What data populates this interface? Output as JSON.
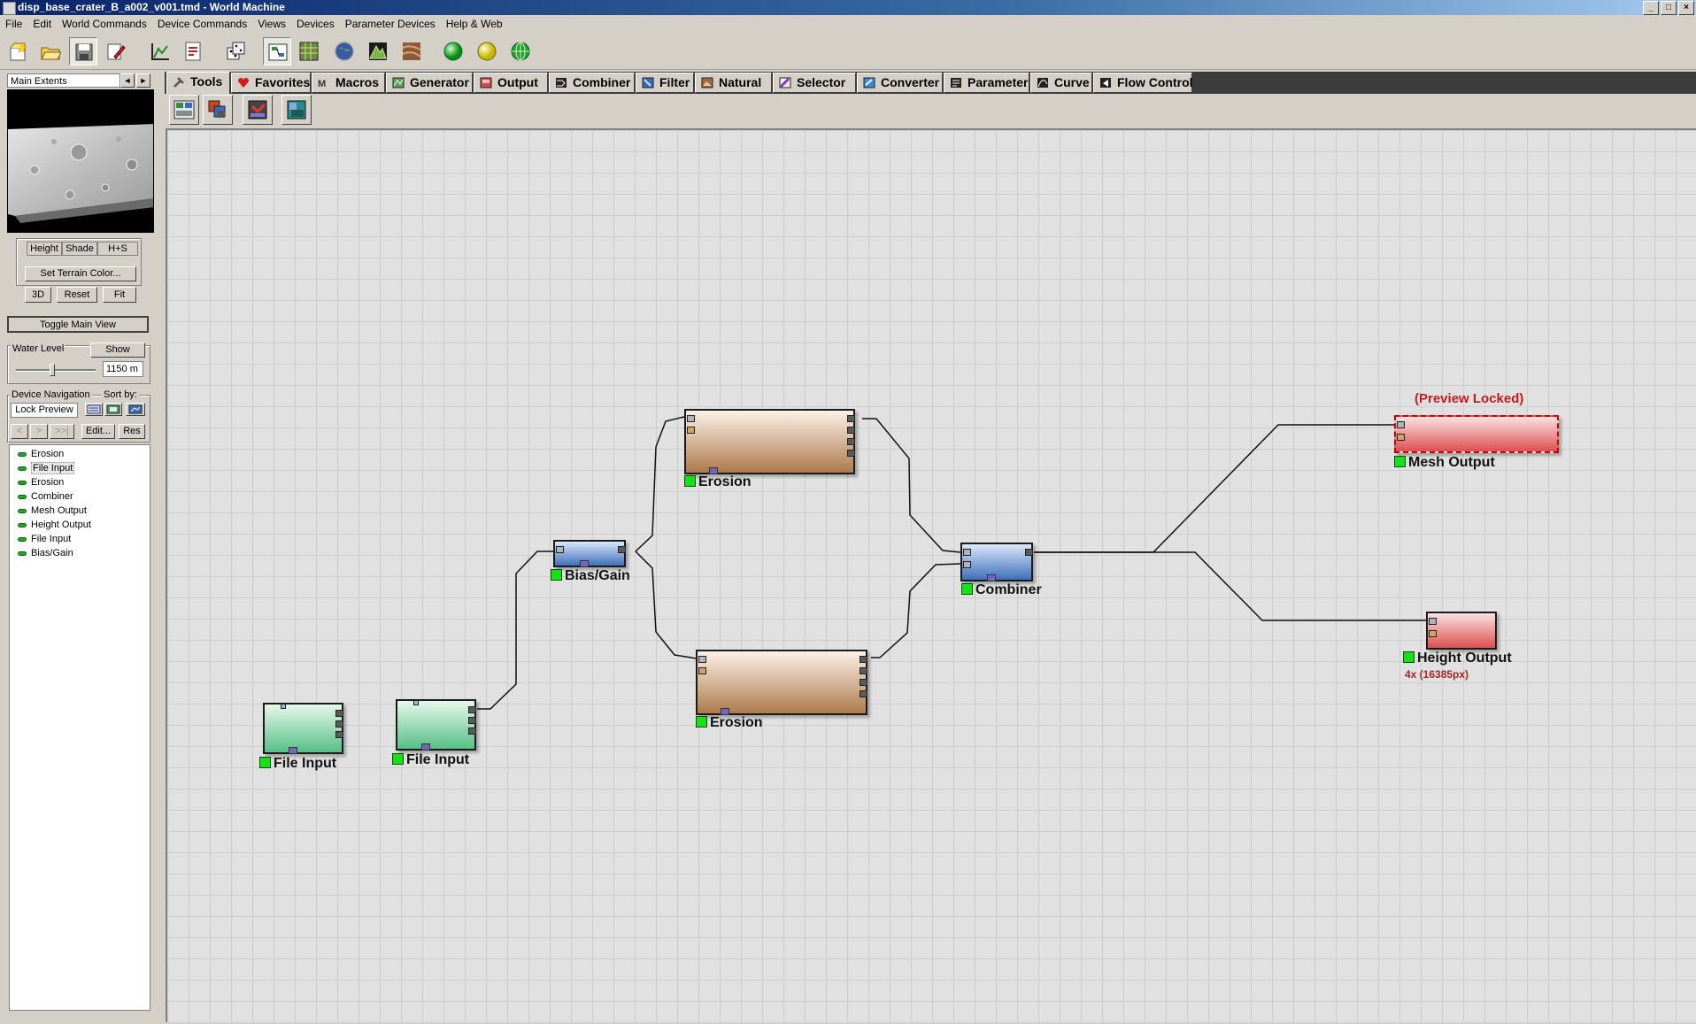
{
  "window": {
    "title": "disp_base_crater_B_a002_v001.tmd - World Machine"
  },
  "menu": [
    "File",
    "Edit",
    "World Commands",
    "Device Commands",
    "Views",
    "Devices",
    "Parameter Devices",
    "Help & Web"
  ],
  "toolbar_icons": [
    "new-file-icon",
    "open-folder-icon",
    "save-icon",
    "edit-script-icon",
    "chart-icon",
    "report-icon",
    "dice-icon",
    "layout-view-icon",
    "grid-view-icon",
    "globe-icon",
    "terrain-icon",
    "texture-icon",
    "build-green-icon",
    "build-yellow-icon",
    "world-build-icon"
  ],
  "left_panel": {
    "extents_label": "Main Extents",
    "view_buttons": [
      "Height",
      "Shade",
      "H+S"
    ],
    "set_terrain_color": "Set Terrain Color...",
    "cam_buttons": [
      "3D",
      "Reset",
      "Fit"
    ],
    "toggle_main_view": "Toggle Main View",
    "water_level_label": "Water Level",
    "water_show": "Show",
    "water_value": "1150 m",
    "device_nav_label": "Device Navigation",
    "sort_by_label": "Sort by:",
    "lock_preview": "Lock Preview",
    "nav_buttons": [
      "<",
      ">",
      ">>|"
    ],
    "edit_button": "Edit...",
    "res_button": "Res",
    "device_list": [
      "Erosion",
      "File Input",
      "Erosion",
      "Combiner",
      "Mesh Output",
      "Height Output",
      "File Input",
      "Bias/Gain"
    ],
    "selected_index": 1
  },
  "tabs": [
    {
      "label": "Tools",
      "icon": "tools-icon",
      "active": true
    },
    {
      "label": "Favorites",
      "icon": "heart-icon"
    },
    {
      "label": "Macros",
      "icon": "macro-icon"
    },
    {
      "label": "Generator",
      "icon": "generator-icon"
    },
    {
      "label": "Output",
      "icon": "output-icon"
    },
    {
      "label": "Combiner",
      "icon": "combiner-icon"
    },
    {
      "label": "Filter",
      "icon": "filter-icon"
    },
    {
      "label": "Natural",
      "icon": "natural-icon"
    },
    {
      "label": "Selector",
      "icon": "selector-icon"
    },
    {
      "label": "Converter",
      "icon": "converter-icon"
    },
    {
      "label": "Parameter",
      "icon": "parameter-icon"
    },
    {
      "label": "Curve",
      "icon": "curve-icon"
    },
    {
      "label": "Flow Control",
      "icon": "flow-control-icon"
    }
  ],
  "tool_buttons": [
    "group-tool-icon",
    "layout-tool-icon",
    "export-tool-icon",
    "library-tool-icon"
  ],
  "nodes": {
    "file_input_1": {
      "label": "File Input"
    },
    "file_input_2": {
      "label": "File Input"
    },
    "bias_gain": {
      "label": "Bias/Gain"
    },
    "erosion_1": {
      "label": "Erosion"
    },
    "erosion_2": {
      "label": "Erosion"
    },
    "combiner": {
      "label": "Combiner"
    },
    "mesh_output": {
      "label": "Mesh Output",
      "status": "(Preview Locked)"
    },
    "height_output": {
      "label": "Height Output",
      "resolution": "4x (16385px)"
    }
  },
  "colors": {
    "generator_node": "#56bf87",
    "filter_node": "#3f6fba",
    "natural_node": "#ad7a4d",
    "output_node": "#dd4f4f",
    "locked_text": "#c21a1a",
    "led_on": "#16e016"
  }
}
